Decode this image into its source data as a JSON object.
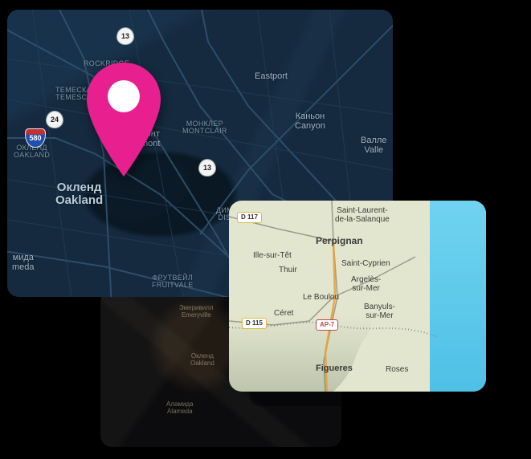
{
  "pin_color": "#e81f8f",
  "oakland_map": {
    "big_label_ru": "Окленд",
    "big_label_en": "Oakland",
    "labels": {
      "eastport": "Eastport",
      "canyon_ru": "Каньон",
      "canyon_en": "Canyon",
      "valle_ru": "Валле",
      "valle_en": "Valle",
      "temescal_ru": "ТЕМЕСКАЛ",
      "temescal_en": "TEMESCAL",
      "rockridge_en": "ROCKRIDGE",
      "piedmont_ru": "Пидмонт",
      "piedmont_en": "Piedmont",
      "montclair_ru": "МОНКЛЕР",
      "montclair_en": "MONTCLAIR",
      "west_oak_ru": "ОКЛЕНД",
      "west_oak_en": "OAKLAND",
      "dimond_ru": "ДИМ",
      "dimond_en": "DIS",
      "alameda_ru": "мида",
      "alameda_en": "meda",
      "fruitvale_ru": "ФРУТВЕЙЛ",
      "fruitvale_en": "FRUITVALE"
    },
    "shields": {
      "i580": "580",
      "r24": "24",
      "r13a": "13",
      "r13b": "13"
    }
  },
  "dark_small_map": {
    "labels": {
      "emeryville_ru": "Эмеривилл",
      "emeryville_en": "Emeryville",
      "oakland_ru": "Окленд",
      "oakland_en": "Oakland",
      "alameda_ru": "Аламида",
      "alameda_en": "Alameda"
    }
  },
  "perpignan_map": {
    "labels": {
      "perpignan": "Perpignan",
      "ille": "Ille-sur-Têt",
      "thuir": "Thuir",
      "st_laurent": "Saint-Laurent-\nde-la-Salanque",
      "st_cyprien": "Saint-Cyprien",
      "argeles": "Argelès-\nsur-Mer",
      "le_boulou": "Le Boulou",
      "ceret": "Céret",
      "banyuls": "Banyuls-\nsur-Mer",
      "figueres": "Figueres",
      "roses": "Roses"
    },
    "road_badges": {
      "d117": "D 117",
      "d115": "D 115",
      "ap7": "AP-7"
    }
  }
}
